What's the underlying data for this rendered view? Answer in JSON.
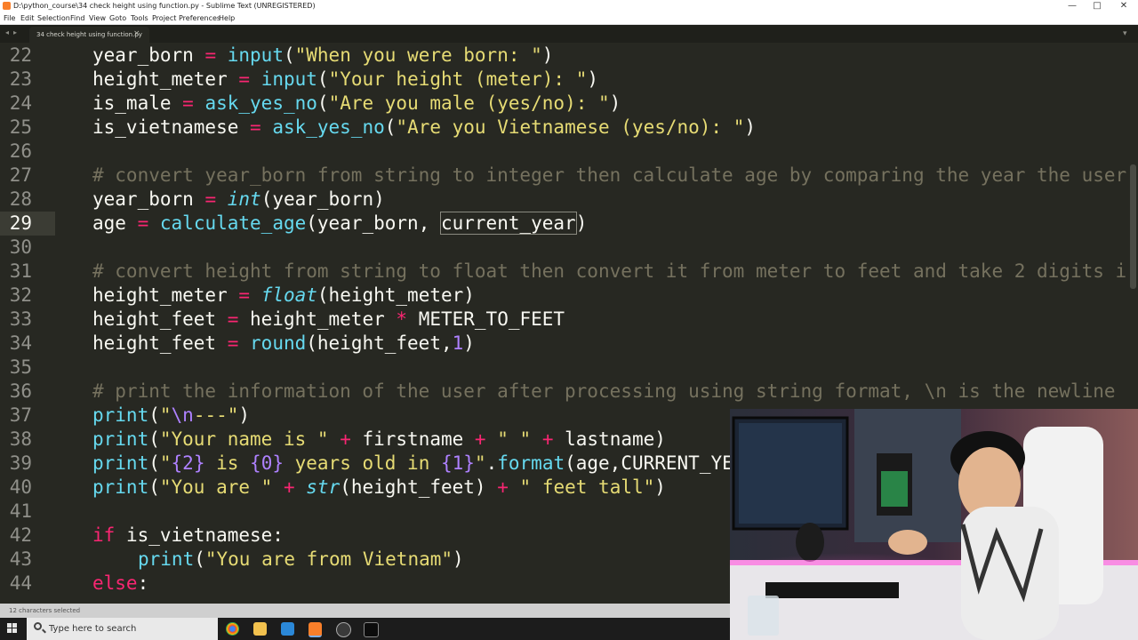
{
  "window": {
    "title": "D:\\python_course\\34 check height using function.py - Sublime Text (UNREGISTERED)",
    "controls": [
      "—",
      "□",
      "✕"
    ]
  },
  "menu": [
    "File",
    "Edit",
    "Selection",
    "Find",
    "View",
    "Goto",
    "Tools",
    "Project",
    "Preferences",
    "Help"
  ],
  "tabs": {
    "nav_left": "◂",
    "nav_right": "▸",
    "active_label": "34 check height using function.py",
    "close": "×",
    "dropdown": "▾"
  },
  "editor": {
    "lines": [
      {
        "n": "22",
        "tokens": [
          [
            "",
            "year_born "
          ],
          [
            "op",
            "="
          ],
          [
            "",
            " "
          ],
          [
            "fn",
            "input"
          ],
          [
            "",
            "("
          ],
          [
            "str",
            "\"When you were born: \""
          ],
          [
            "",
            ")"
          ]
        ]
      },
      {
        "n": "23",
        "tokens": [
          [
            "",
            "height_meter "
          ],
          [
            "op",
            "="
          ],
          [
            "",
            " "
          ],
          [
            "fn",
            "input"
          ],
          [
            "",
            "("
          ],
          [
            "str",
            "\"Your height (meter): \""
          ],
          [
            "",
            ")"
          ]
        ]
      },
      {
        "n": "24",
        "tokens": [
          [
            "",
            "is_male "
          ],
          [
            "op",
            "="
          ],
          [
            "",
            " "
          ],
          [
            "fn",
            "ask_yes_no"
          ],
          [
            "",
            "("
          ],
          [
            "str",
            "\"Are you male (yes/no): \""
          ],
          [
            "",
            ")"
          ]
        ]
      },
      {
        "n": "25",
        "tokens": [
          [
            "",
            "is_vietnamese "
          ],
          [
            "op",
            "="
          ],
          [
            "",
            " "
          ],
          [
            "fn",
            "ask_yes_no"
          ],
          [
            "",
            "("
          ],
          [
            "str",
            "\"Are you Vietnamese (yes/no): \""
          ],
          [
            "",
            ")"
          ]
        ]
      },
      {
        "n": "26",
        "tokens": []
      },
      {
        "n": "27",
        "tokens": [
          [
            "cm",
            "# convert year_born from string to integer then calculate age by comparing the year the user"
          ]
        ]
      },
      {
        "n": "28",
        "tokens": [
          [
            "",
            "year_born "
          ],
          [
            "op",
            "="
          ],
          [
            "",
            " "
          ],
          [
            "it",
            "int"
          ],
          [
            "",
            "(year_born)"
          ]
        ]
      },
      {
        "n": "29",
        "active": true,
        "tokens": [
          [
            "",
            "age "
          ],
          [
            "op",
            "="
          ],
          [
            "",
            " "
          ],
          [
            "fn",
            "calculate_age"
          ],
          [
            "",
            "(year_born, "
          ],
          [
            "sel",
            "current_year"
          ],
          [
            "",
            ")"
          ]
        ]
      },
      {
        "n": "30",
        "tokens": []
      },
      {
        "n": "31",
        "tokens": [
          [
            "cm",
            "# convert height from string to float then convert it from meter to feet and take 2 digits i"
          ]
        ]
      },
      {
        "n": "32",
        "tokens": [
          [
            "",
            "height_meter "
          ],
          [
            "op",
            "="
          ],
          [
            "",
            " "
          ],
          [
            "it",
            "float"
          ],
          [
            "",
            "(height_meter)"
          ]
        ]
      },
      {
        "n": "33",
        "tokens": [
          [
            "",
            "height_feet "
          ],
          [
            "op",
            "="
          ],
          [
            "",
            " height_meter "
          ],
          [
            "op",
            "*"
          ],
          [
            "",
            " METER_TO_FEET"
          ]
        ]
      },
      {
        "n": "34",
        "tokens": [
          [
            "",
            "height_feet "
          ],
          [
            "op",
            "="
          ],
          [
            "",
            " "
          ],
          [
            "fn",
            "round"
          ],
          [
            "",
            "(height_feet,"
          ],
          [
            "num",
            "1"
          ],
          [
            "",
            ")"
          ]
        ]
      },
      {
        "n": "35",
        "tokens": []
      },
      {
        "n": "36",
        "tokens": [
          [
            "cm",
            "# print the information of the user after processing using string format, \\n is the newline"
          ]
        ]
      },
      {
        "n": "37",
        "tokens": [
          [
            "fn",
            "print"
          ],
          [
            "",
            "("
          ],
          [
            "str",
            "\""
          ],
          [
            "num",
            "\\n"
          ],
          [
            "str",
            "---\""
          ],
          [
            "",
            ")"
          ]
        ]
      },
      {
        "n": "38",
        "tokens": [
          [
            "fn",
            "print"
          ],
          [
            "",
            "("
          ],
          [
            "str",
            "\"Your name is \""
          ],
          [
            "",
            " "
          ],
          [
            "op",
            "+"
          ],
          [
            "",
            " firstname "
          ],
          [
            "op",
            "+"
          ],
          [
            "",
            " "
          ],
          [
            "str",
            "\" \""
          ],
          [
            "",
            " "
          ],
          [
            "op",
            "+"
          ],
          [
            "",
            " lastname)"
          ]
        ]
      },
      {
        "n": "39",
        "tokens": [
          [
            "fn",
            "print"
          ],
          [
            "",
            "("
          ],
          [
            "str",
            "\""
          ],
          [
            "num",
            "{2}"
          ],
          [
            "str",
            " is "
          ],
          [
            "num",
            "{0}"
          ],
          [
            "str",
            " years old in "
          ],
          [
            "num",
            "{1}"
          ],
          [
            "str",
            "\""
          ],
          [
            "",
            "."
          ],
          [
            "fn",
            "format"
          ],
          [
            "",
            "(age,CURRENT_YE"
          ]
        ]
      },
      {
        "n": "40",
        "tokens": [
          [
            "fn",
            "print"
          ],
          [
            "",
            "("
          ],
          [
            "str",
            "\"You are \""
          ],
          [
            "",
            " "
          ],
          [
            "op",
            "+"
          ],
          [
            "",
            " "
          ],
          [
            "it",
            "str"
          ],
          [
            "",
            "(height_feet) "
          ],
          [
            "op",
            "+"
          ],
          [
            "",
            " "
          ],
          [
            "str",
            "\" feet tall\""
          ],
          [
            "",
            ")"
          ]
        ]
      },
      {
        "n": "41",
        "tokens": []
      },
      {
        "n": "42",
        "tokens": [
          [
            "kw",
            "if"
          ],
          [
            "",
            " is_vietnamese:"
          ]
        ]
      },
      {
        "n": "43",
        "indent": true,
        "tokens": [
          [
            "fn",
            "print"
          ],
          [
            "",
            "("
          ],
          [
            "str",
            "\"You are from Vietnam\""
          ],
          [
            "",
            ")"
          ]
        ]
      },
      {
        "n": "44",
        "tokens": [
          [
            "kw",
            "else"
          ],
          [
            "",
            ":"
          ]
        ]
      }
    ]
  },
  "status": {
    "text": "12 characters selected"
  },
  "taskbar": {
    "search_placeholder": "Type here to search",
    "icons": [
      "windows-start-icon",
      "chrome-icon",
      "file-explorer-icon",
      "mail-icon",
      "sublime-text-icon",
      "obs-icon",
      "terminal-icon"
    ]
  },
  "colors": {
    "background": "#272822",
    "comment": "#75715e",
    "string": "#e6db74",
    "keyword": "#f92672",
    "function": "#66d9ef",
    "number": "#ae81ff"
  }
}
